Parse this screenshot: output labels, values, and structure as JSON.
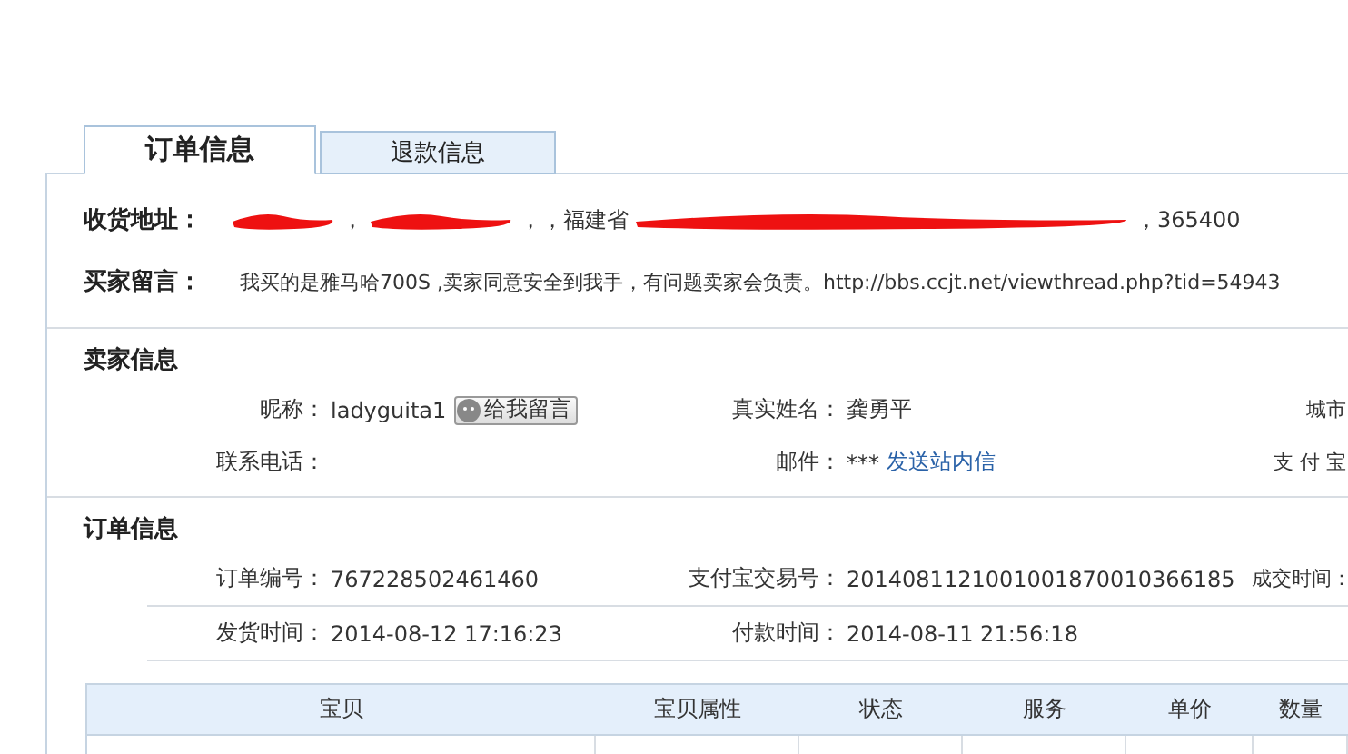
{
  "tabs": [
    {
      "label": "订单信息",
      "selected": true
    },
    {
      "label": "退款信息",
      "selected": false
    }
  ],
  "address": {
    "label": "收货地址：",
    "segments": [
      {
        "kind": "redacted"
      },
      {
        "kind": "text",
        "text": "，"
      },
      {
        "kind": "redacted"
      },
      {
        "kind": "text",
        "text": "，"
      },
      {
        "kind": "text",
        "text": "，福建省"
      },
      {
        "kind": "redacted"
      },
      {
        "kind": "text",
        "text": "，365400"
      }
    ]
  },
  "buyer_message": {
    "label": "买家留言：",
    "text": "我买的是雅马哈700S ,卖家同意安全到我手，有问题卖家会负责。http://bbs.ccjt.net/viewthread.php?tid=54943"
  },
  "seller_info": {
    "title": "卖家信息",
    "rows": [
      [
        {
          "label": "昵称：",
          "value": "ladyguita1",
          "button": "给我留言"
        },
        {
          "label": "真实姓名：",
          "value": "龚勇平"
        },
        {
          "label": "城市"
        }
      ],
      [
        {
          "label": "联系电话："
        },
        {
          "label": "邮件：",
          "value": "***",
          "link": "发送站内信"
        },
        {
          "label": "支 付 宝"
        }
      ]
    ]
  },
  "order_info": {
    "title": "订单信息",
    "rows": [
      [
        {
          "label": "订单编号：",
          "value": "767228502461460"
        },
        {
          "label": "支付宝交易号：",
          "value": "2014081121001001870010366185"
        },
        {
          "label": "成交时间："
        }
      ],
      [
        {
          "label": "发货时间：",
          "value": "2014-08-12 17:16:23"
        },
        {
          "label": "付款时间：",
          "value": "2014-08-11 21:56:18"
        }
      ]
    ]
  },
  "table": {
    "columns": [
      "宝贝",
      "宝贝属性",
      "状态",
      "服务",
      "单价",
      "数量"
    ]
  }
}
